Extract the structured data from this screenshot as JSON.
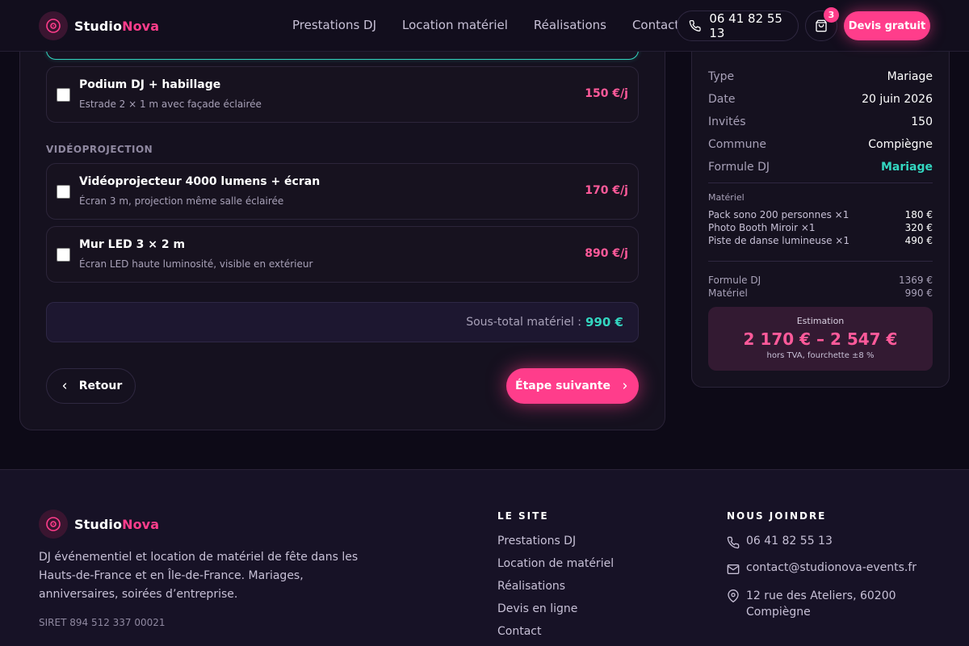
{
  "brand": {
    "part1": "Studio",
    "part2": "Nova"
  },
  "nav": {
    "links": [
      "Prestations DJ",
      "Location matériel",
      "Réalisations",
      "Contact"
    ],
    "phone": "06 41 82 55 13",
    "cart_count": "3",
    "cta": "Devis gratuit"
  },
  "equipment": {
    "items": [
      {
        "title": "Podium DJ + habillage",
        "desc": "Estrade 2 × 1 m avec façade éclairée",
        "price": "150 €/j",
        "checked": false
      }
    ],
    "video_section": "VIDÉOPROJECTION",
    "video_items": [
      {
        "title": "Vidéoprojecteur 4000 lumens + écran",
        "desc": "Écran 3 m, projection même salle éclairée",
        "price": "170 €/j",
        "checked": false
      },
      {
        "title": "Mur LED 3 × 2 m",
        "desc": "Écran LED haute luminosité, visible en extérieur",
        "price": "890 €/j",
        "checked": false
      }
    ],
    "subtotal_label": "Sous-total matériel :",
    "subtotal_value": "990 €",
    "back_label": "Retour",
    "next_label": "Étape suivante"
  },
  "summary": {
    "rows": [
      {
        "k": "Type",
        "v": "Mariage"
      },
      {
        "k": "Date",
        "v": "20 juin 2026"
      },
      {
        "k": "Invités",
        "v": "150"
      },
      {
        "k": "Commune",
        "v": "Compiègne"
      },
      {
        "k": "Formule DJ",
        "v": "Mariage"
      }
    ],
    "material_title": "Matériel",
    "material": [
      {
        "k": "Pack sono 200 personnes ×1",
        "v": "180 €"
      },
      {
        "k": "Photo Booth Miroir ×1",
        "v": "320 €"
      },
      {
        "k": "Piste de danse lumineuse ×1",
        "v": "490 €"
      }
    ],
    "totals": [
      {
        "k": "Formule DJ",
        "v": "1369 €"
      },
      {
        "k": "Matériel",
        "v": "990 €"
      }
    ],
    "estimate_label": "Estimation",
    "estimate_range": "2 170 € – 2 547 €",
    "estimate_note": "hors TVA, fourchette ±8 %"
  },
  "footer": {
    "description": "DJ événementiel et location de matériel de fête dans les Hauts-de-France et en Île-de-France. Mariages, anniversaires, soirées d’entreprise.",
    "siret": "SIRET 894 512 337 00021",
    "site_heading": "LE SITE",
    "site_links": [
      "Prestations DJ",
      "Location de matériel",
      "Réalisations",
      "Devis en ligne",
      "Contact"
    ],
    "contact_heading": "NOUS JOINDRE",
    "phone": "06 41 82 55 13",
    "email": "contact@studionova-events.fr",
    "address": "12 rue des Ateliers, 60200 Compiègne"
  },
  "colors": {
    "accent_pink": "#ff3d8b",
    "accent_teal": "#33d6c0",
    "background": "#0d0a17"
  }
}
